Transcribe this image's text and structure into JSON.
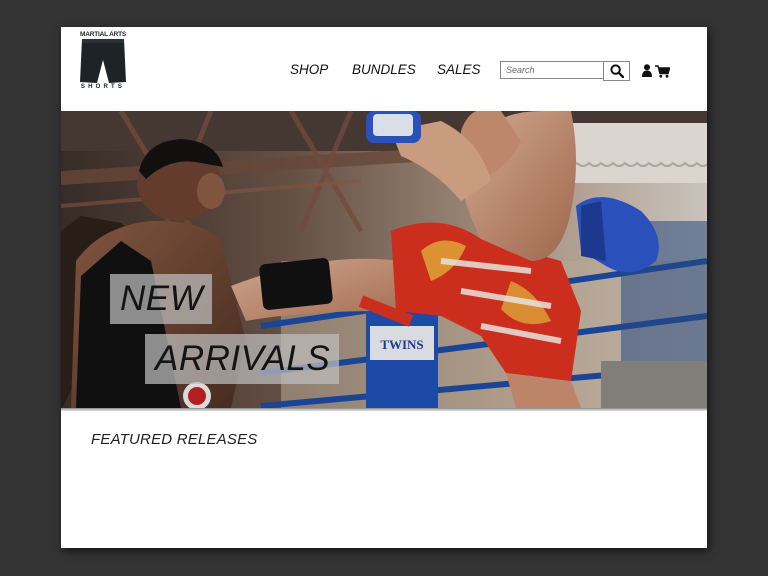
{
  "brand": {
    "logo_top_text": "MARTIAL ARTS",
    "logo_bottom_text": "SHORTS",
    "logo_color": "#1d2326"
  },
  "nav": {
    "items": [
      {
        "label": "SHOP"
      },
      {
        "label": "BUNDLES"
      },
      {
        "label": "SALES"
      }
    ]
  },
  "search": {
    "placeholder": "Search",
    "icon": "search-icon"
  },
  "header_icons": [
    "user-icon",
    "cart-icon"
  ],
  "hero": {
    "line1": "NEW",
    "line2": "ARRIVALS",
    "glove_color": "#2d55c8",
    "shorts_color": "#d8311e",
    "pad_text": "TWINS"
  },
  "featured": {
    "title": "FEATURED RELEASES"
  },
  "colors": {
    "background": "#333333",
    "page": "#ffffff",
    "text": "#111111"
  }
}
